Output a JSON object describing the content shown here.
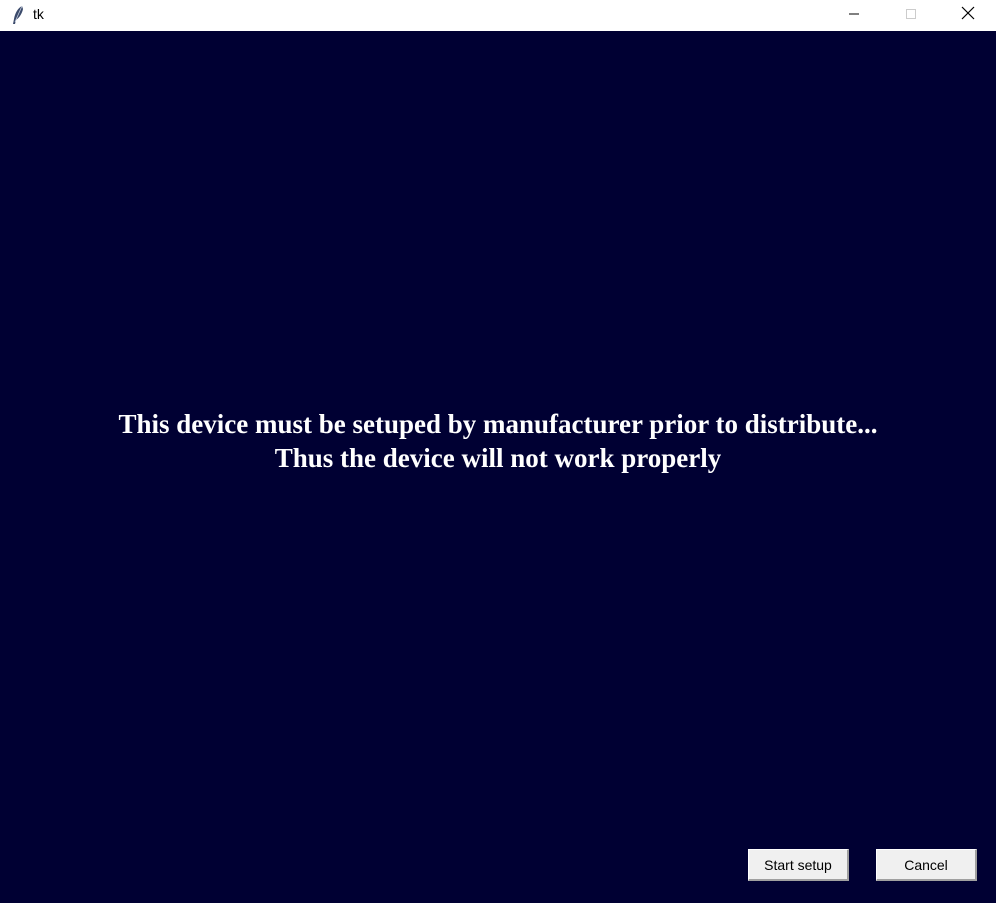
{
  "window": {
    "title": "tk",
    "icon": "feather-icon",
    "controls": {
      "minimize": "minimize-icon",
      "maximize": "maximize-icon",
      "close": "close-icon"
    }
  },
  "message": {
    "line1": "This device must be setuped by manufacturer prior to distribute...",
    "line2": "Thus the device will not work properly"
  },
  "buttons": {
    "start_setup": "Start setup",
    "cancel": "Cancel"
  },
  "colors": {
    "background": "#000033",
    "text": "#ffffff",
    "button_face": "#f0f0f0"
  }
}
